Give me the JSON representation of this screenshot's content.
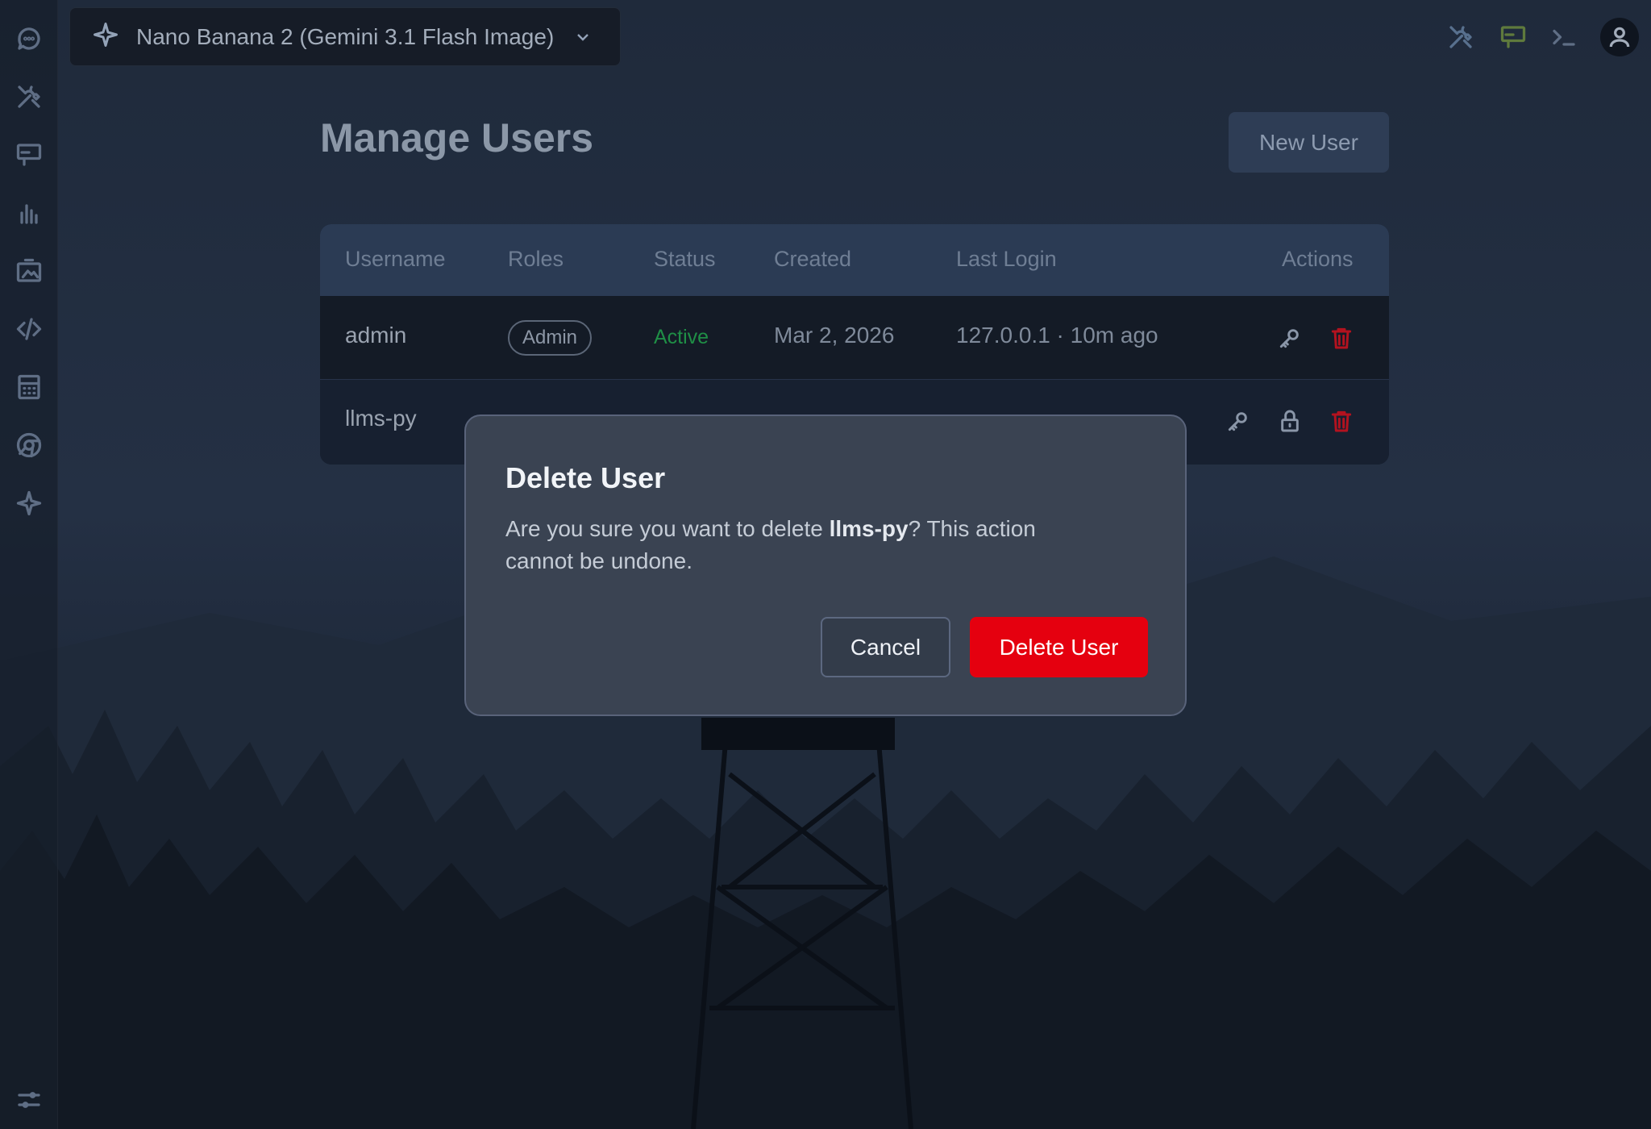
{
  "model_selector": {
    "label": "Nano Banana 2 (Gemini 3.1 Flash Image)"
  },
  "sidebar": {
    "icons": [
      "chat-icon",
      "tools-icon",
      "presentation-icon",
      "analytics-icon",
      "gallery-icon",
      "code-icon",
      "calculator-icon",
      "chrome-icon",
      "sparkle-icon",
      "sliders-icon"
    ]
  },
  "topbar": {
    "icons": [
      "tools-icon",
      "presentation-icon",
      "terminal-icon",
      "user-avatar-icon"
    ]
  },
  "page": {
    "title": "Manage Users",
    "new_user_label": "New User"
  },
  "table": {
    "headers": [
      "Username",
      "Roles",
      "Status",
      "Created",
      "Last Login",
      "Actions"
    ],
    "rows": [
      {
        "username": "admin",
        "role": "Admin",
        "status": "Active",
        "created": "Mar 2, 2026",
        "last_login": "127.0.0.1 · 10m ago"
      },
      {
        "username": "llms-py"
      }
    ]
  },
  "modal": {
    "title": "Delete User",
    "message_before": "Are you sure you want to delete ",
    "message_user": "llms-py",
    "message_after": "? This action cannot be undone.",
    "cancel_label": "Cancel",
    "delete_label": "Delete User"
  },
  "colors": {
    "accent_red": "#e5000f",
    "active_green": "#1f8f46",
    "header_blue": "#2b3b54"
  }
}
